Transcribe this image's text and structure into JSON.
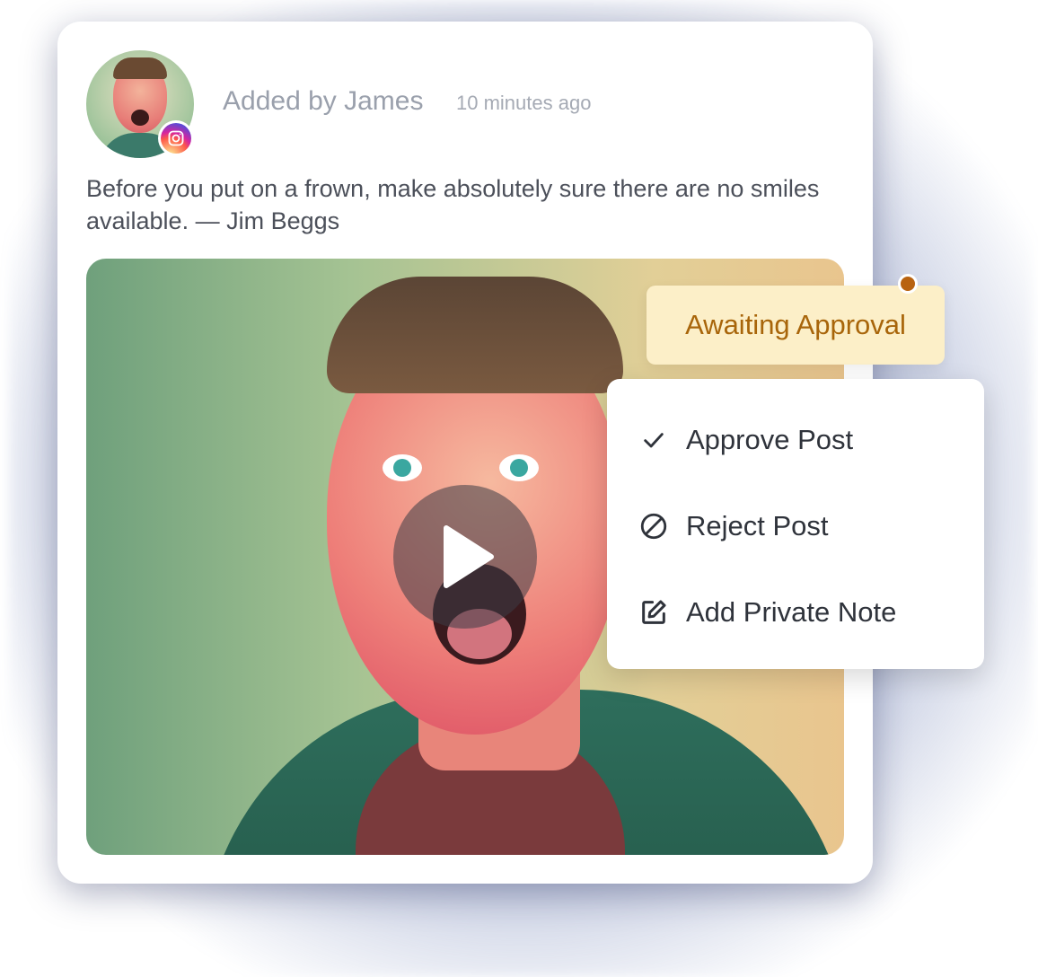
{
  "post": {
    "author_line": "Added by James",
    "timestamp": "10 minutes ago",
    "caption": "Before you put on a frown, make absolutely sure there are no smiles available. — Jim Beggs",
    "network": "instagram-icon",
    "media_type": "video"
  },
  "status": {
    "label": "Awaiting Approval",
    "color": "#a8650a",
    "background": "#fcefc8"
  },
  "menu": {
    "items": [
      {
        "label": "Approve Post",
        "icon": "check-icon"
      },
      {
        "label": "Reject Post",
        "icon": "block-icon"
      },
      {
        "label": "Add Private Note",
        "icon": "edit-note-icon"
      }
    ]
  },
  "colors": {
    "instagram_gradient": [
      "#fdf497",
      "#fd5949",
      "#d6249f",
      "#285aeb"
    ],
    "status_dot": "#b8620f"
  }
}
